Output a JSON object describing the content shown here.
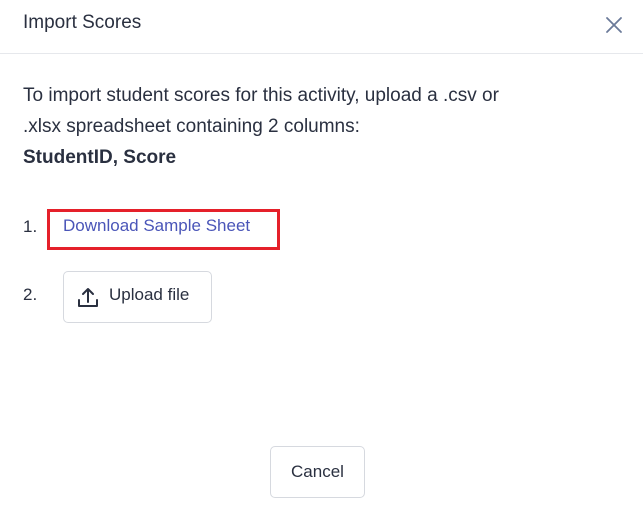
{
  "dialog": {
    "title": "Import Scores",
    "close_icon": "close-icon"
  },
  "intro": {
    "text": "To import student scores for this activity, upload a .csv or .xlsx spreadsheet containing 2 columns:",
    "columns": "StudentID, Score"
  },
  "steps": [
    {
      "number": "1.",
      "link_label": "Download Sample Sheet"
    },
    {
      "number": "2.",
      "button_label": "Upload file",
      "icon": "upload-icon"
    }
  ],
  "footer": {
    "cancel_label": "Cancel"
  },
  "colors": {
    "link": "#4a55b8",
    "highlight": "#e5202a",
    "text": "#2a3040",
    "border": "#d6d9df"
  }
}
